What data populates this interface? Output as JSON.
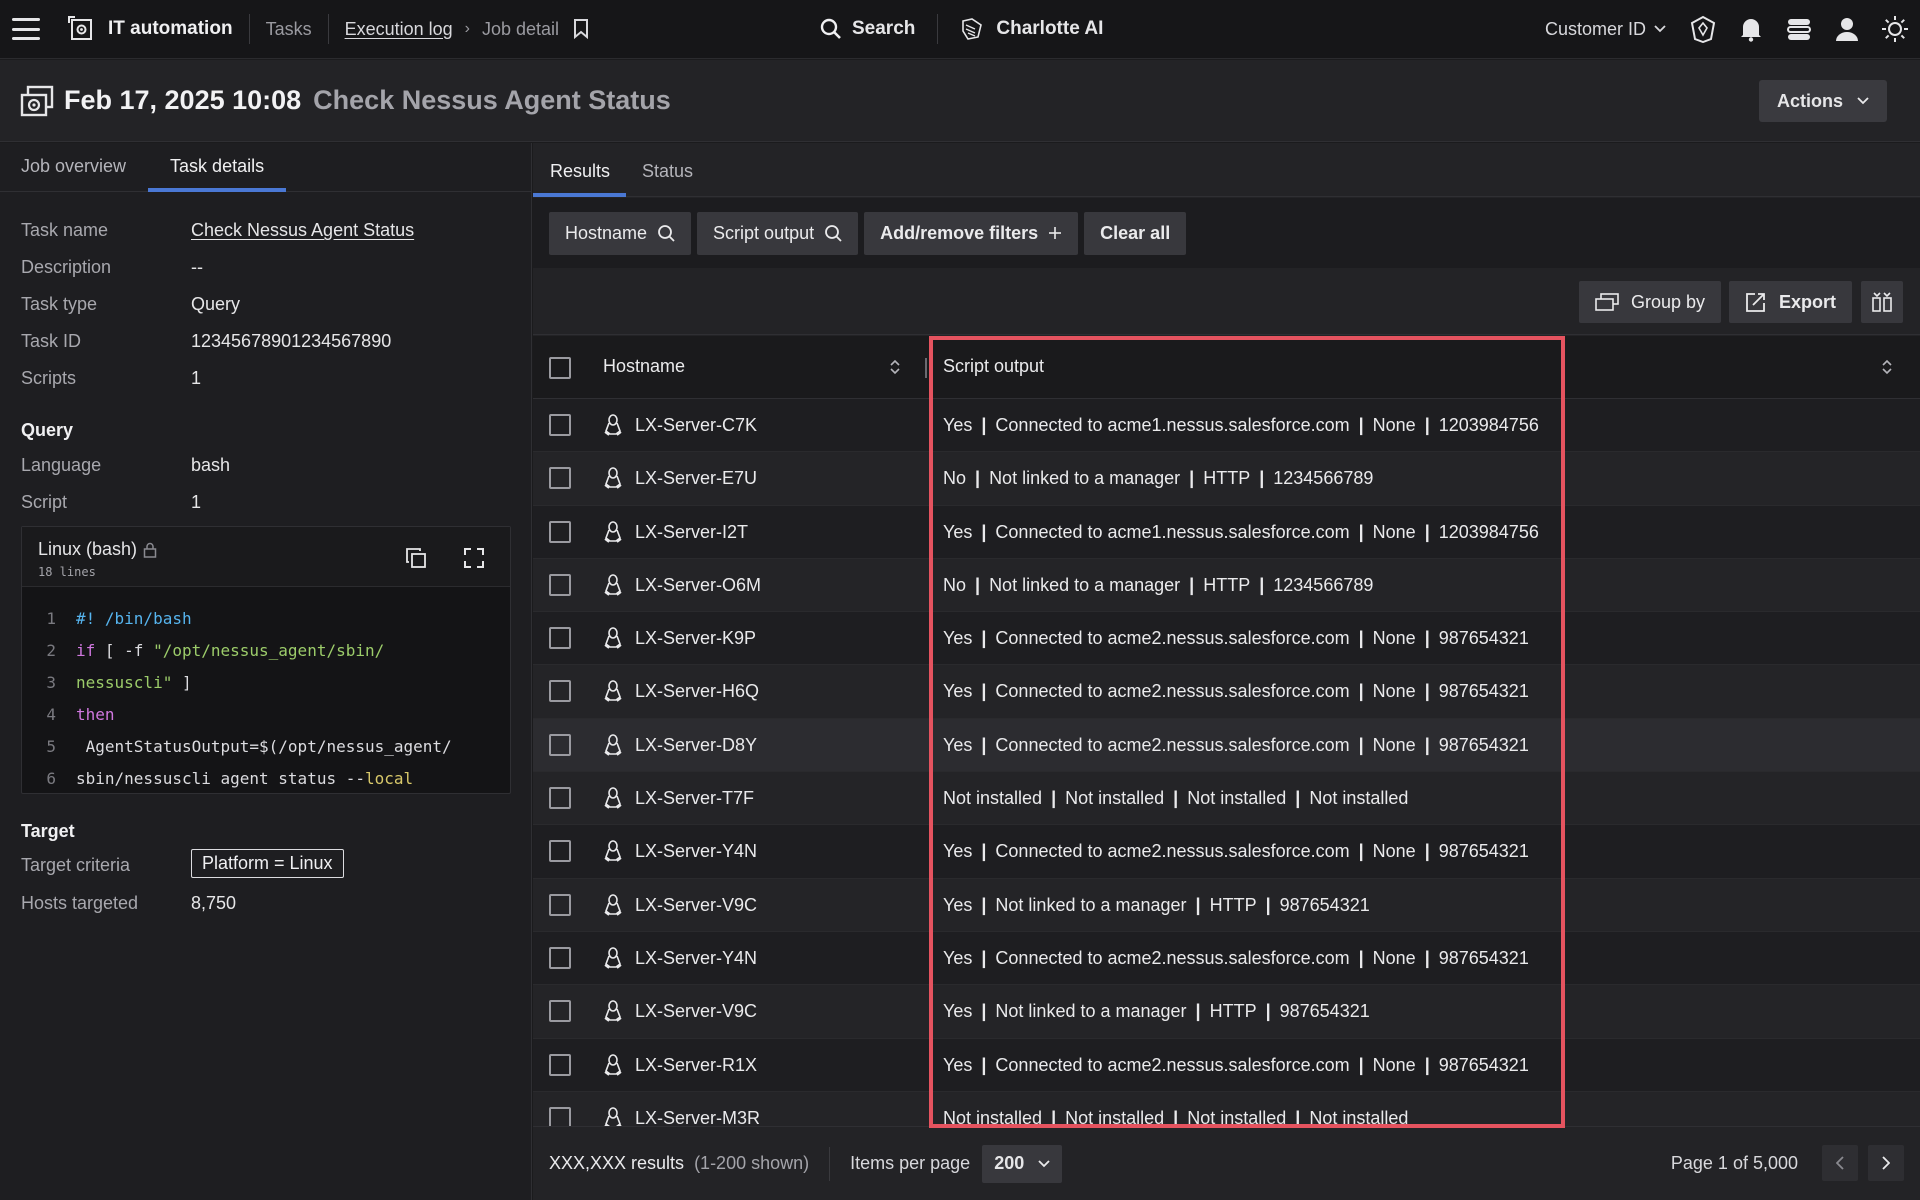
{
  "topbar": {
    "app_title": "IT automation",
    "breadcrumb": [
      "Tasks",
      "Execution log",
      "Job detail"
    ],
    "search_label": "Search",
    "ai_label": "Charlotte AI",
    "customer_label": "Customer ID",
    "icons": [
      "menu-icon",
      "app-icon",
      "bookmark-icon",
      "search-icon",
      "charlotte-ai-icon",
      "chevron-down-icon",
      "shield-icon",
      "bell-icon",
      "support-icon",
      "user-icon",
      "theme-sun-icon"
    ]
  },
  "header": {
    "date": "Feb 17, 2025 10:08",
    "title": "Check Nessus Agent Status",
    "actions_label": "Actions"
  },
  "left": {
    "tabs": [
      "Job overview",
      "Task details"
    ],
    "active_tab": "Task details",
    "task": [
      {
        "k": "Task name",
        "v": "Check Nessus Agent Status"
      },
      {
        "k": "Description",
        "v": "--"
      },
      {
        "k": "Task type",
        "v": "Query"
      },
      {
        "k": "Task ID",
        "v": "12345678901234567890"
      },
      {
        "k": "Scripts",
        "v": "1"
      }
    ],
    "query_heading": "Query",
    "query": [
      {
        "k": "Language",
        "v": "bash"
      },
      {
        "k": "Script",
        "v": "1"
      }
    ],
    "code": {
      "lang": "Linux (bash)",
      "lines_count": "18 lines",
      "lines": [
        {
          "n": "1",
          "t": "#! /bin/bash"
        },
        {
          "n": "2",
          "t": "if [ -f \"/opt/nessus_agent/sbin/"
        },
        {
          "n": "3",
          "t": "nessuscli\" ]"
        },
        {
          "n": "4",
          "t": "then"
        },
        {
          "n": "5",
          "t": " AgentStatusOutput=$(/opt/nessus_agent/"
        },
        {
          "n": "6",
          "t": "sbin/nessuscli agent status --local"
        }
      ]
    },
    "target_heading": "Target",
    "target": [
      {
        "k": "Target criteria",
        "v": "Platform = Linux"
      },
      {
        "k": "Hosts targeted",
        "v": "8,750"
      }
    ]
  },
  "right": {
    "tabs": [
      "Results",
      "Status"
    ],
    "active_tab": "Results",
    "filters": {
      "hostname": "Hostname",
      "script_output": "Script output",
      "add_remove": "Add/remove filters",
      "clear": "Clear all"
    },
    "tools": {
      "group_by": "Group by",
      "export": "Export"
    },
    "columns": {
      "hostname": "Hostname",
      "script_output": "Script output"
    },
    "rows": [
      {
        "host": "LX-Server-C7K",
        "out": [
          "Yes",
          "Connected to acme1.nessus.salesforce.com",
          "None",
          "1203984756"
        ]
      },
      {
        "host": "LX-Server-E7U",
        "out": [
          "No",
          "Not linked to a manager",
          "HTTP",
          "1234566789"
        ]
      },
      {
        "host": "LX-Server-I2T",
        "out": [
          "Yes",
          "Connected to acme1.nessus.salesforce.com",
          "None",
          "1203984756"
        ]
      },
      {
        "host": "LX-Server-O6M",
        "out": [
          "No",
          "Not linked to a manager",
          "HTTP",
          "1234566789"
        ]
      },
      {
        "host": "LX-Server-K9P",
        "out": [
          "Yes",
          "Connected to acme2.nessus.salesforce.com",
          "None",
          "987654321"
        ]
      },
      {
        "host": "LX-Server-H6Q",
        "out": [
          "Yes",
          "Connected to acme2.nessus.salesforce.com",
          "None",
          "987654321"
        ]
      },
      {
        "host": "LX-Server-D8Y",
        "out": [
          "Yes",
          "Connected to acme2.nessus.salesforce.com",
          "None",
          "987654321"
        ]
      },
      {
        "host": "LX-Server-T7F",
        "out": [
          "Not installed",
          "Not installed",
          "Not installed",
          "Not installed"
        ]
      },
      {
        "host": "LX-Server-Y4N",
        "out": [
          "Yes",
          "Connected to acme2.nessus.salesforce.com",
          "None",
          "987654321"
        ]
      },
      {
        "host": "LX-Server-V9C",
        "out": [
          "Yes",
          "Not linked to a manager",
          "HTTP",
          "987654321"
        ]
      },
      {
        "host": "LX-Server-Y4N",
        "out": [
          "Yes",
          "Connected to acme2.nessus.salesforce.com",
          "None",
          "987654321"
        ]
      },
      {
        "host": "LX-Server-V9C",
        "out": [
          "Yes",
          "Not linked to a manager",
          "HTTP",
          "987654321"
        ]
      },
      {
        "host": "LX-Server-R1X",
        "out": [
          "Yes",
          "Connected to acme2.nessus.salesforce.com",
          "None",
          "987654321"
        ]
      },
      {
        "host": "LX-Server-M3R",
        "out": [
          "Not installed",
          "Not installed",
          "Not installed",
          "Not installed"
        ]
      }
    ],
    "footer": {
      "results": "XXX,XXX results",
      "shown": "(1-200 shown)",
      "items_per_page_label": "Items per page",
      "items_per_page": "200",
      "page": "Page 1 of 5,000"
    }
  },
  "colors": {
    "accent_tab": "#4a78d4",
    "highlight_border": "#e5535f",
    "background": "#1b1b1d"
  }
}
